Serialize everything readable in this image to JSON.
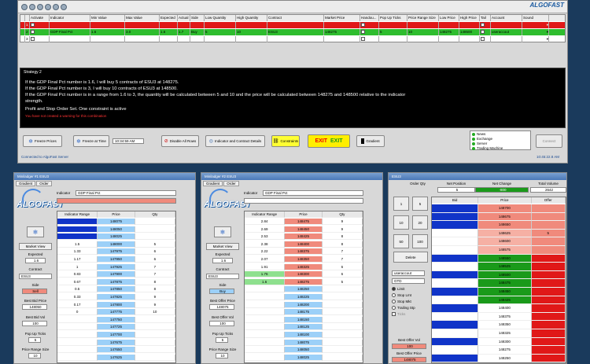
{
  "top_logo": "ALGOFAST",
  "grid": {
    "headers": [
      "",
      "",
      "Activate",
      "Indicator",
      "Min Value",
      "Max Value",
      "Expected",
      "Actual",
      "Side",
      "Low Quantity",
      "High Quantity",
      "Contract",
      "Market Price",
      "Handou...",
      "Pop Up Ticks",
      "Price Range Size",
      "Low Price",
      "High Price",
      "Tail",
      "Account",
      "Sound"
    ],
    "rows": [
      {
        "num": "1",
        "indicator": "",
        "min": "",
        "max": "",
        "expected": "",
        "actual": "",
        "side": "",
        "lowq": "",
        "highq": "",
        "contract": "",
        "market": "",
        "ticks": "",
        "range": "",
        "low": "",
        "high": "",
        "account": "",
        "style": "red"
      },
      {
        "num": "2",
        "indicator": "GDP Final Pct",
        "min": "1.6",
        "max": "3.0",
        "expected": "1.6",
        "actual": "1.7",
        "side": "Buy",
        "lowq": "5",
        "highq": "10",
        "contract": "ESU3",
        "market": "148275",
        "ticks": "5",
        "range": "10",
        "low": "148275",
        "high": "148500",
        "account": "useraccout",
        "style": "green"
      },
      {
        "num": "3",
        "indicator": "",
        "min": "",
        "max": "",
        "expected": "",
        "actual": "",
        "side": "",
        "lowq": "",
        "highq": "",
        "contract": "",
        "market": "",
        "ticks": "",
        "range": "",
        "low": "",
        "high": "",
        "account": "",
        "style": "white"
      }
    ]
  },
  "strategy": {
    "label": "Strategy 2",
    "lines": [
      "If the GDP Final Pct number is 1.6, I will buy 5 contracts of ESU3 at 148275.",
      "If the GDP Final Pct number is 3, I will buy 10 contracts of ESU3 at 148500.",
      "If the GDP Final Pct number is in a range from 1.6 to 3, the quantity will be calculated between 5 and 10 and the price will be calculated between 148275 and 148500 relative to the indicator",
      "strength.",
      "Profit and Stop Order Set.  One constraint is active"
    ],
    "warning": "You have not created a warning for this combination"
  },
  "buttons": {
    "freeze_prices": "Freeze Prices",
    "freeze_at_time": "Freeze at Time",
    "time_value": "10:34:59 AM",
    "disable_all_rows": "Disable All Rows",
    "indicator_details": "Indicator and Contract Details",
    "constraints": "Constraints",
    "exit1": "EXIT",
    "exit2": "EXIT",
    "gradient": "Gradient",
    "connect": "Connect"
  },
  "feeds": [
    "News",
    "Exchange",
    "Server",
    "Trading Machine"
  ],
  "status": {
    "connected": "Connected to AlgoFast Server",
    "clock": "10:45:22.8 AM"
  },
  "panel1": {
    "title": "Miniladger #1 ESU3",
    "tabs": [
      "Gradient",
      "Order"
    ],
    "logo": "ALGOFAST",
    "indicator_label": "Indicator",
    "indicator_value": "GDP Final Pct",
    "market_view": "Market View",
    "expected_label": "Expected",
    "expected_value": "1.6",
    "contract_label": "Contract",
    "contract_value": "ESU3",
    "side_label": "Side",
    "side_value": "Sell",
    "best_bid_price_label": "Best Bid Price",
    "best_bid_price": "148050",
    "best_bid_vol_label": "Best Bid Vol",
    "best_bid_vol": "100",
    "popup_label": "Pop Up Ticks",
    "popup_value": "5",
    "range_label": "Price Range Size",
    "range_value": "10",
    "col_headers": [
      "Indicator Range",
      "Price",
      "Qty"
    ],
    "rows": [
      {
        "ind": "",
        "price": "148075",
        "qty": ""
      },
      {
        "ind": "",
        "price": "148050",
        "qty": ""
      },
      {
        "ind": "",
        "price": "148025",
        "qty": ""
      },
      {
        "ind": "1.5",
        "price": "148000",
        "qty": "5"
      },
      {
        "ind": "1.33",
        "price": "147975",
        "qty": "6"
      },
      {
        "ind": "1.17",
        "price": "147950",
        "qty": "6"
      },
      {
        "ind": "1",
        "price": "147925",
        "qty": "7"
      },
      {
        "ind": "0.83",
        "price": "147900",
        "qty": "7"
      },
      {
        "ind": "0.67",
        "price": "147875",
        "qty": "8"
      },
      {
        "ind": "0.5",
        "price": "147850",
        "qty": "8"
      },
      {
        "ind": "0.33",
        "price": "147825",
        "qty": "9"
      },
      {
        "ind": "0.17",
        "price": "147800",
        "qty": "9"
      },
      {
        "ind": "0",
        "price": "147775",
        "qty": "10"
      },
      {
        "ind": "",
        "price": "147750",
        "qty": ""
      },
      {
        "ind": "",
        "price": "147725",
        "qty": ""
      },
      {
        "ind": "",
        "price": "147700",
        "qty": ""
      },
      {
        "ind": "",
        "price": "147675",
        "qty": ""
      },
      {
        "ind": "",
        "price": "147650",
        "qty": ""
      },
      {
        "ind": "",
        "price": "147625",
        "qty": ""
      }
    ]
  },
  "panel2": {
    "title": "Miniladger #2 ESU3",
    "tabs": [
      "Gradient",
      "Order"
    ],
    "logo": "ALGOFAST",
    "indicator_label": "Indicator",
    "indicator_value": "GDP Final Pct",
    "market_view": "Market View",
    "expected_label": "Expected",
    "expected_value": "1.6",
    "contract_label": "Contract",
    "contract_value": "ESU3",
    "side_label": "Side",
    "side_value": "Buy",
    "best_offer_price_label": "Best Offer Price",
    "best_offer_price": "148075",
    "best_offer_vol_label": "Best Offer Vol",
    "best_offer_vol": "100",
    "popup_label": "Pop Up Ticks",
    "popup_value": "5",
    "range_label": "Price Range Size",
    "range_value": "10",
    "col_headers": [
      "Indicator Range",
      "Price",
      "Qty"
    ],
    "rows": [
      {
        "ind": "2.84",
        "price": "148475",
        "qty": "9"
      },
      {
        "ind": "2.69",
        "price": "148450",
        "qty": "9"
      },
      {
        "ind": "2.53",
        "price": "148425",
        "qty": "8"
      },
      {
        "ind": "2.38",
        "price": "148400",
        "qty": "8"
      },
      {
        "ind": "2.22",
        "price": "148375",
        "qty": "7"
      },
      {
        "ind": "2.07",
        "price": "148350",
        "qty": "7"
      },
      {
        "ind": "1.91",
        "price": "148325",
        "qty": "6"
      },
      {
        "ind": "1.76",
        "price": "148300",
        "qty": "6"
      },
      {
        "ind": "1.6",
        "price": "148275",
        "qty": "5"
      },
      {
        "ind": "",
        "price": "148250",
        "qty": ""
      },
      {
        "ind": "",
        "price": "148225",
        "qty": ""
      },
      {
        "ind": "",
        "price": "148200",
        "qty": ""
      },
      {
        "ind": "",
        "price": "148175",
        "qty": ""
      },
      {
        "ind": "",
        "price": "148150",
        "qty": ""
      },
      {
        "ind": "",
        "price": "148125",
        "qty": ""
      },
      {
        "ind": "",
        "price": "148100",
        "qty": ""
      },
      {
        "ind": "",
        "price": "148075",
        "qty": ""
      },
      {
        "ind": "",
        "price": "148050",
        "qty": ""
      },
      {
        "ind": "",
        "price": "148025",
        "qty": ""
      }
    ]
  },
  "panel3": {
    "title": "ESU3",
    "order_qty_label": "Order Qty",
    "net_position_label": "Net Position",
    "net_position": "5",
    "net_change_label": "Net Change",
    "net_change": "-800",
    "total_volume_label": "Total Volume",
    "total_volume": "2642",
    "qty_buttons": [
      "1",
      "5",
      "10",
      "20",
      "50",
      "100"
    ],
    "delete_label": "Delete",
    "account_value": "useraccout",
    "tif_value": "GTD",
    "order_types": [
      "Limit",
      "Stop Lmt",
      "Stop Mkt",
      "Trailing Stp"
    ],
    "ticks_label": "Ticks",
    "best_offer_vol_label": "Best Offer Vol",
    "best_offer_vol": "100",
    "best_offer_price_label": "Best Offer Price",
    "best_offer_price": "148075",
    "col_headers": [
      "Bid",
      "Price",
      "Offer"
    ],
    "rows": [
      {
        "bid": "",
        "price": "148700",
        "offer": "",
        "style": "blue-red"
      },
      {
        "bid": "",
        "price": "148675",
        "offer": "",
        "style": "blue-red"
      },
      {
        "bid": "",
        "price": "148650",
        "offer": "",
        "style": "blue-red"
      },
      {
        "bid": "",
        "price": "148625",
        "offer": "5",
        "style": "white-red"
      },
      {
        "bid": "",
        "price": "148600",
        "offer": "",
        "style": "white-red"
      },
      {
        "bid": "",
        "price": "148575",
        "offer": "",
        "style": "white-red"
      },
      {
        "bid": "",
        "price": "148550",
        "offer": "",
        "style": "blue-green"
      },
      {
        "bid": "",
        "price": "148525",
        "offer": "",
        "style": "blue-green"
      },
      {
        "bid": "",
        "price": "148500",
        "offer": "",
        "style": "blue-green"
      },
      {
        "bid": "",
        "price": "148475",
        "offer": "",
        "style": "blue-green"
      },
      {
        "bid": "",
        "price": "148450",
        "offer": "",
        "style": "blue-green"
      },
      {
        "bid": "",
        "price": "148425",
        "offer": "",
        "style": "blue-green"
      },
      {
        "bid": "",
        "price": "148400",
        "offer": "",
        "style": "blue-green"
      },
      {
        "bid": "",
        "price": "148375",
        "offer": "",
        "style": "blue-green"
      },
      {
        "bid": "",
        "price": "148350",
        "offer": "",
        "style": "blue-green"
      },
      {
        "bid": "",
        "price": "148325",
        "offer": "",
        "style": "blue-green"
      },
      {
        "bid": "",
        "price": "148300",
        "offer": "",
        "style": "blue-green"
      },
      {
        "bid": "",
        "price": "148275",
        "offer": "",
        "style": "blue-green"
      },
      {
        "bid": "",
        "price": "148250",
        "offer": "",
        "style": "blue-green"
      }
    ]
  },
  "colors": {
    "red": "#e01818",
    "green": "#2ebd2e",
    "blue": "#1034c8",
    "ltblue": "#9cd0f8",
    "salmon": "#f08a7c",
    "ltgreen": "#8ee08e"
  }
}
